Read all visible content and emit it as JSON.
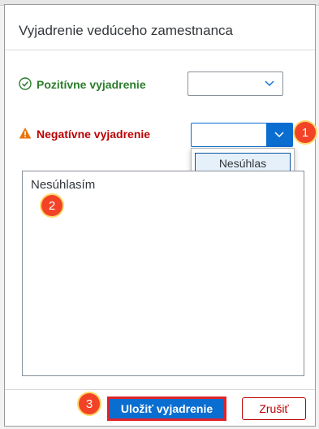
{
  "dialog": {
    "title": "Vyjadrenie vedúceho zamestnanca",
    "positive": {
      "label": "Pozitívne vyjadrenie",
      "selected": ""
    },
    "negative": {
      "label": "Negatívne vyjadrenie",
      "selected": ""
    },
    "dropdown_options": [
      "Nesúhlas"
    ],
    "comment": "Nesúhlasím",
    "buttons": {
      "save": "Uložiť vyjadrenie",
      "cancel": "Zrušiť"
    }
  },
  "badges": [
    "1",
    "2",
    "3"
  ],
  "icons": {
    "positive": "check-circle-icon",
    "negative": "warning-triangle-icon",
    "dropdown": "chevron-down-icon"
  },
  "colors": {
    "accent": "#0a6ed1",
    "positive": "#2b7d2b",
    "negative": "#bb0000",
    "warning": "#e9730c",
    "badge": "#f24326"
  }
}
